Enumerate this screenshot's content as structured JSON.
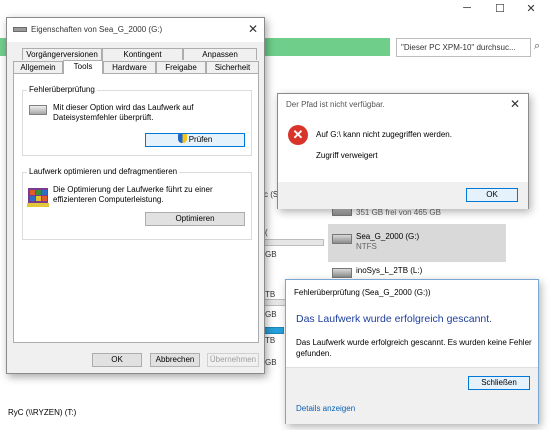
{
  "explorer": {
    "search_placeholder": "\"Dieser PC XPM-10\" durchsuc...",
    "drive_a_suffix": "c (S:",
    "drives": [
      {
        "sub": "351 GB frei von 465 GB",
        "usage": 0.25
      },
      {
        "name": "Sea_G_2000 (G:)",
        "sub": "NTFS"
      },
      {
        "name": "inoSys_L_2TB (L:)"
      }
    ],
    "fragments": [
      "GB",
      "TB",
      "GB",
      "TB",
      "GB"
    ],
    "network_drive": "RyC (\\\\RYZEN) (T:)"
  },
  "properties": {
    "title": "Eigenschaften von Sea_G_2000 (G:)",
    "tabs_row1": [
      "Vorgängerversionen",
      "Kontingent",
      "Anpassen"
    ],
    "tabs_row2": [
      "Allgemein",
      "Tools",
      "Hardware",
      "Freigabe",
      "Sicherheit"
    ],
    "active_tab": "Tools",
    "error_check": {
      "title": "Fehlerüberprüfung",
      "text": "Mit dieser Option wird das Laufwerk auf Dateisystemfehler überprüft.",
      "button": "Prüfen"
    },
    "optimize": {
      "title": "Laufwerk optimieren und defragmentieren",
      "text": "Die Optimierung der Laufwerke führt zu einer effizienteren Computerleistung.",
      "button": "Optimieren"
    },
    "buttons": {
      "ok": "OK",
      "cancel": "Abbrechen",
      "apply": "Übernehmen"
    }
  },
  "error_dialog": {
    "title": "Der Pfad ist nicht verfügbar.",
    "message": "Auf G:\\ kann nicht zugegriffen werden.",
    "detail": "Zugriff verweigert",
    "ok": "OK"
  },
  "scan_dialog": {
    "title": "Fehlerüberprüfung (Sea_G_2000 (G:))",
    "heading": "Das Laufwerk wurde erfolgreich gescannt.",
    "text": "Das Laufwerk wurde erfolgreich gescannt. Es wurden keine Fehler gefunden.",
    "close": "Schließen",
    "details_link": "Details anzeigen"
  },
  "colors": {
    "accent_blue": "#0078d7",
    "error_red": "#d9342b",
    "heading_blue": "#1e3f9e",
    "greenbar": "#6fcf8a"
  }
}
